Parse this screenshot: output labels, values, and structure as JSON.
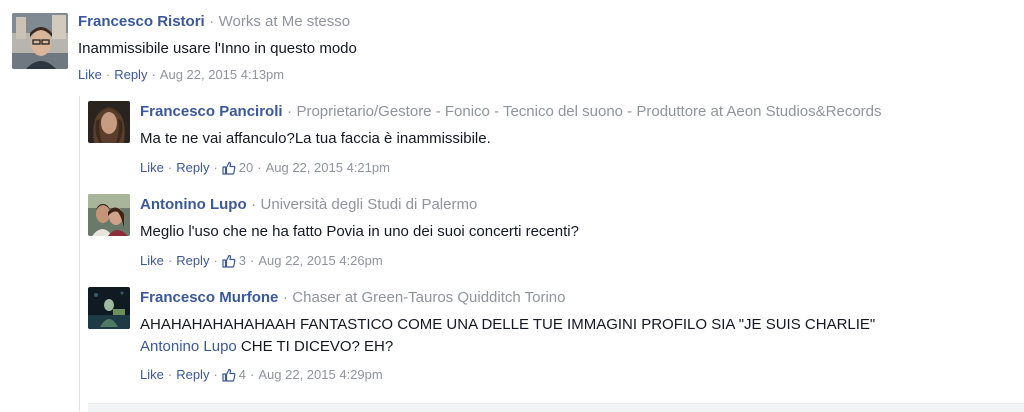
{
  "comments": [
    {
      "author": "Francesco Ristori",
      "work": "Works at Me stesso",
      "text": "Inammissibile usare l'Inno in questo modo",
      "like": "Like",
      "reply": "Reply",
      "time": "Aug 22, 2015 4:13pm"
    },
    {
      "author": "Francesco Panciroli",
      "work": "Proprietario/Gestore - Fonico - Tecnico del suono - Produttore at Aeon Studios&Records",
      "text": "Ma te ne vai affanculo?La tua faccia è inammissibile.",
      "like": "Like",
      "reply": "Reply",
      "likes": "20",
      "time": "Aug 22, 2015 4:21pm"
    },
    {
      "author": "Antonino Lupo",
      "work": "Università degli Studi di Palermo",
      "text": "Meglio l'uso che ne ha fatto Povia in uno dei suoi concerti recenti?",
      "like": "Like",
      "reply": "Reply",
      "likes": "3",
      "time": "Aug 22, 2015 4:26pm"
    },
    {
      "author": "Francesco Murfone",
      "work": "Chaser at Green-Tauros Quidditch Torino",
      "text": "AHAHAHAHAHAHAAH FANTASTICO COME UNA DELLE TUE IMMAGINI PROFILO SIA \"JE SUIS CHARLIE\"",
      "mention": "Antonino Lupo",
      "text2": " CHE TI DICEVO? EH?",
      "like": "Like",
      "reply": "Reply",
      "likes": "4",
      "time": "Aug 22, 2015 4:29pm"
    }
  ],
  "separator": "·"
}
